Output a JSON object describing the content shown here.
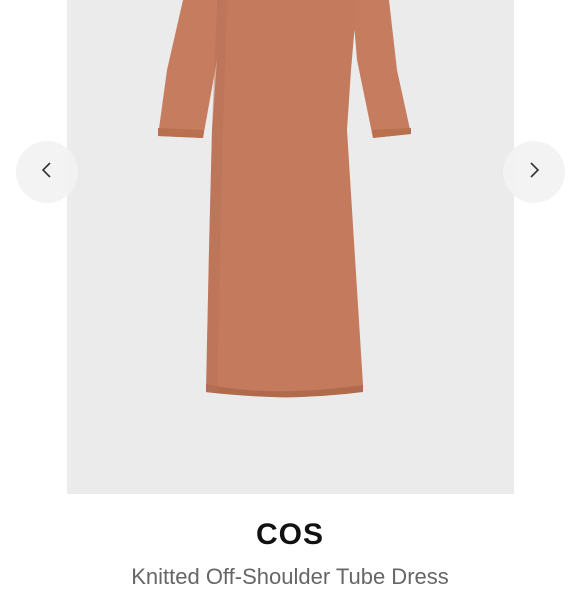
{
  "product": {
    "brand": "COS",
    "title": "Knitted Off-Shoulder Tube Dress",
    "color": "#c67d5f"
  },
  "carousel": {
    "prev_icon": "chevron-left-icon",
    "next_icon": "chevron-right-icon"
  }
}
